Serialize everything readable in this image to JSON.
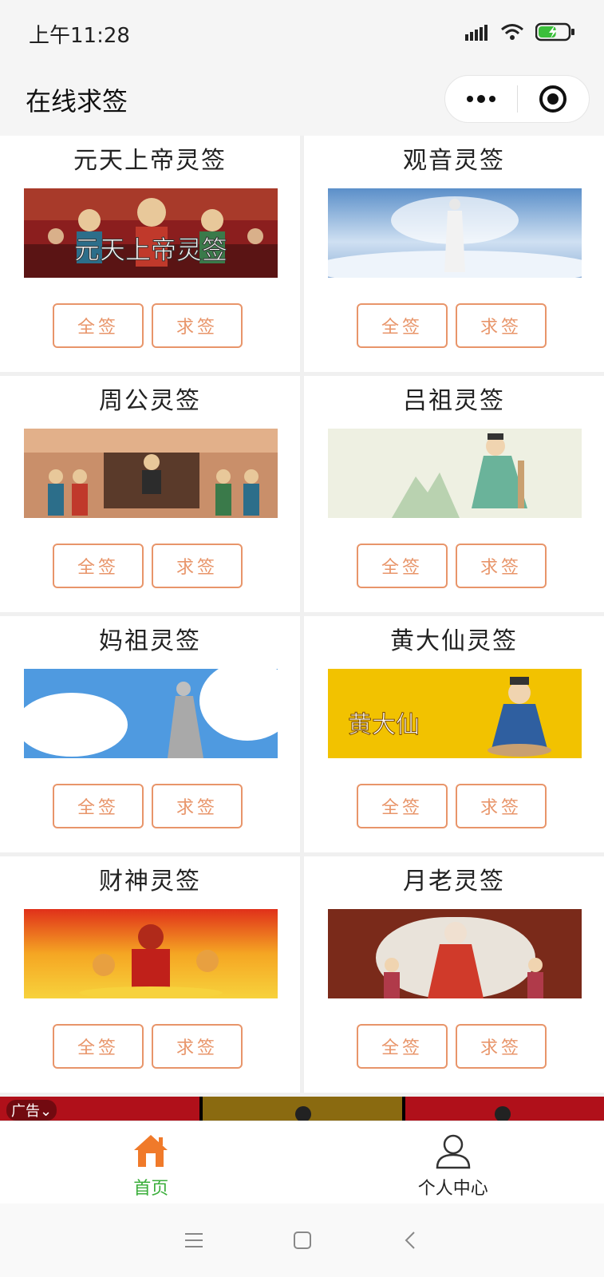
{
  "status": {
    "time": "上午11:28",
    "battery_pct": 0.6,
    "battery_color": "#3bbf3b"
  },
  "nav": {
    "title": "在线求签"
  },
  "accent": "#e8956a",
  "cards": [
    {
      "title": "元天上帝灵签",
      "image_caption": "元天上帝灵签",
      "btn_all": "全签",
      "btn_draw": "求签"
    },
    {
      "title": "观音灵签",
      "btn_all": "全签",
      "btn_draw": "求签"
    },
    {
      "title": "周公灵签",
      "btn_all": "全签",
      "btn_draw": "求签"
    },
    {
      "title": "吕祖灵签",
      "btn_all": "全签",
      "btn_draw": "求签"
    },
    {
      "title": "妈祖灵签",
      "btn_all": "全签",
      "btn_draw": "求签"
    },
    {
      "title": "黄大仙灵签",
      "image_caption": "黄大仙",
      "btn_all": "全签",
      "btn_draw": "求签"
    },
    {
      "title": "财神灵签",
      "btn_all": "全签",
      "btn_draw": "求签"
    },
    {
      "title": "月老灵签",
      "btn_all": "全签",
      "btn_draw": "求签"
    }
  ],
  "ad": {
    "label": "广告"
  },
  "tabs": [
    {
      "label": "首页",
      "icon": "home-icon",
      "active": true,
      "color": "#3bae3b"
    },
    {
      "label": "个人中心",
      "icon": "user-icon",
      "active": false,
      "color": "#222222"
    }
  ]
}
